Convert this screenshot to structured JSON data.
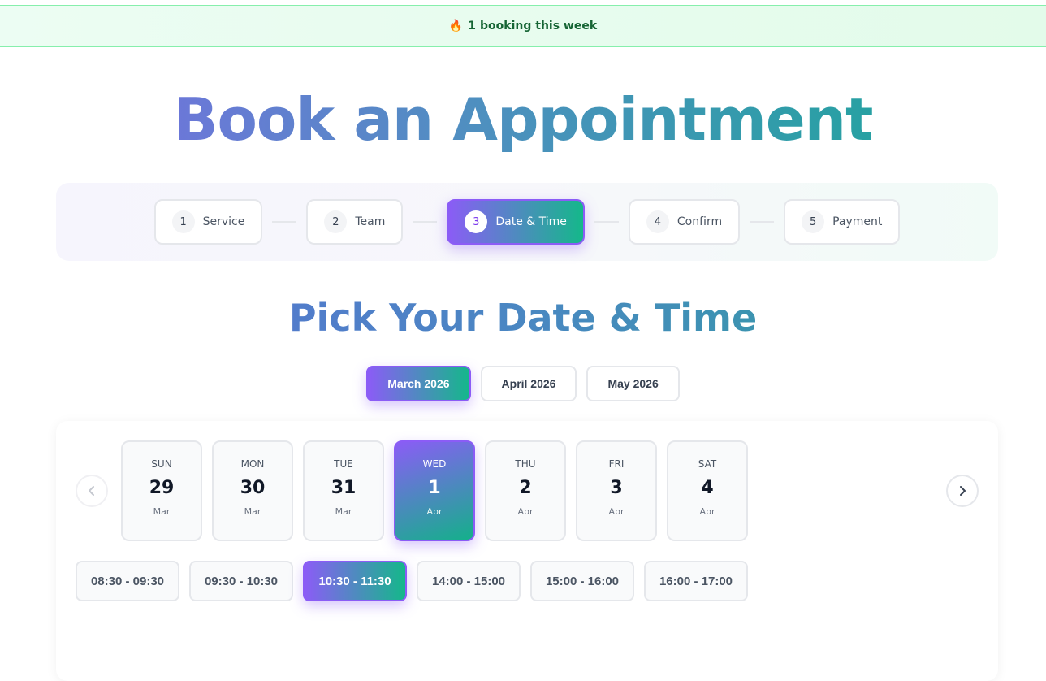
{
  "banner": {
    "icon": "fire-icon",
    "count": "1",
    "text": "booking this week"
  },
  "page": {
    "title": "Book an Appointment",
    "subtitle": "Pick Your Date & Time"
  },
  "steps": [
    {
      "num": "1",
      "label": "Service"
    },
    {
      "num": "2",
      "label": "Team"
    },
    {
      "num": "3",
      "label": "Date & Time"
    },
    {
      "num": "4",
      "label": "Confirm"
    },
    {
      "num": "5",
      "label": "Payment"
    }
  ],
  "months": [
    "March 2026",
    "April 2026",
    "May 2026"
  ],
  "days": [
    {
      "dow": "SUN",
      "num": "29",
      "mon": "Mar"
    },
    {
      "dow": "MON",
      "num": "30",
      "mon": "Mar"
    },
    {
      "dow": "TUE",
      "num": "31",
      "mon": "Mar"
    },
    {
      "dow": "WED",
      "num": "1",
      "mon": "Apr"
    },
    {
      "dow": "THU",
      "num": "2",
      "mon": "Apr"
    },
    {
      "dow": "FRI",
      "num": "3",
      "mon": "Apr"
    },
    {
      "dow": "SAT",
      "num": "4",
      "mon": "Apr"
    }
  ],
  "slots": [
    "08:30 - 09:30",
    "09:30 - 10:30",
    "10:30 - 11:30",
    "14:00 - 15:00",
    "15:00 - 16:00",
    "16:00 - 17:00"
  ],
  "colors": {
    "accent_start": "#8b5cf6",
    "accent_end": "#14b88a",
    "banner_bg": "#ecfdf3",
    "banner_text": "#166534"
  },
  "icons": {
    "prev": "chevron-left-icon",
    "next": "chevron-right-icon"
  }
}
